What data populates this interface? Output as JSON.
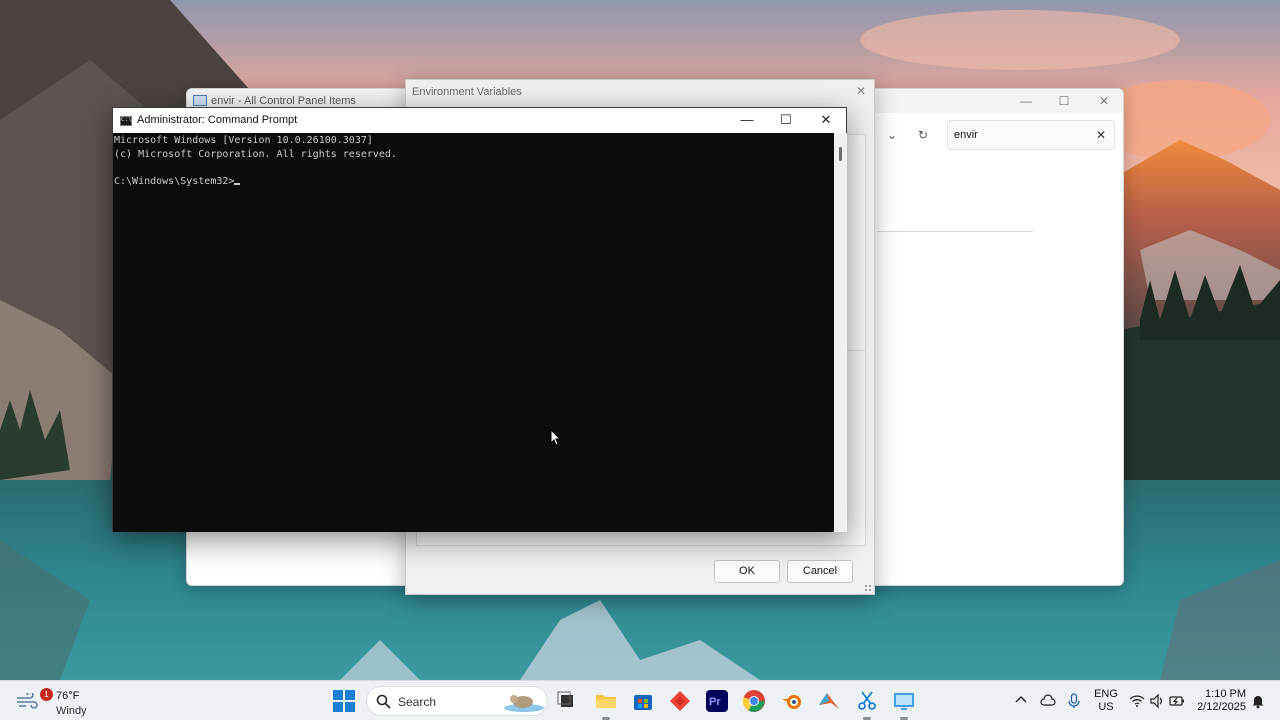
{
  "control_panel": {
    "title": "envir - All Control Panel Items",
    "search_value": "envir",
    "minimize_glyph": "—",
    "maximize_glyph": "☐",
    "close_glyph": "✕",
    "back_glyph": "⌄",
    "refresh_glyph": "↻",
    "clear_glyph": "✕"
  },
  "env_dialog": {
    "title": "Environment Variables",
    "close_glyph": "✕",
    "ok_label": "OK",
    "cancel_label": "Cancel"
  },
  "cmd": {
    "title": "Administrator: Command Prompt",
    "minimize_glyph": "—",
    "maximize_glyph": "☐",
    "close_glyph": "✕",
    "lines": [
      "Microsoft Windows [Version 10.0.26100.3037]",
      "(c) Microsoft Corporation. All rights reserved.",
      "",
      "C:\\Windows\\System32>"
    ]
  },
  "taskbar": {
    "weather": {
      "temperature": "76°F",
      "condition": "Windy",
      "badge_count": "1"
    },
    "search_placeholder": "Search",
    "language": {
      "line1": "ENG",
      "line2": "US"
    },
    "clock": {
      "time": "1:10 PM",
      "date": "2/12/2025"
    },
    "apps": [
      "file-explorer-icon",
      "microsoft-store-icon",
      "anydesk-icon",
      "premiere-pro-icon",
      "chrome-icon",
      "blender-icon",
      "matlab-icon",
      "snipping-tool-icon",
      "remote-desktop-icon"
    ]
  },
  "colors": {
    "console_bg": "#0c0c0c",
    "console_text": "#cccccc",
    "taskbar_bg": "#eef1f5",
    "accent": "#0067c0"
  }
}
